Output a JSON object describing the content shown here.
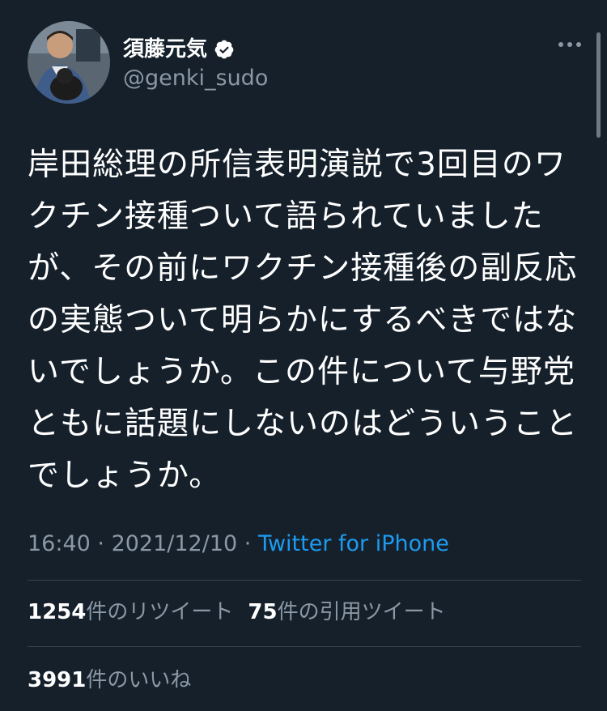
{
  "user": {
    "display_name": "須藤元気",
    "handle": "@genki_sudo",
    "verified_icon": "verified-badge-icon"
  },
  "tweet": {
    "text": "岸田総理の所信表明演説で3回目のワクチン接種ついて語られていましたが、その前にワクチン接種後の副反応の実態ついて明らかにするべきではないでしょうか。この件について与野党ともに話題にしないのはどういうことでしょうか。",
    "time": "16:40",
    "date": "2021/12/10",
    "separator": " · ",
    "source": "Twitter for iPhone"
  },
  "stats": {
    "retweets_count": "1254",
    "retweets_label": "件のリツイート",
    "quotes_count": "75",
    "quotes_label": "件の引用ツイート",
    "likes_count": "3991",
    "likes_label": "件のいいね"
  },
  "colors": {
    "background": "#15202b",
    "text": "#ffffff",
    "secondary": "#8b98a5",
    "link": "#1d9bf0",
    "divider": "#38444d"
  }
}
